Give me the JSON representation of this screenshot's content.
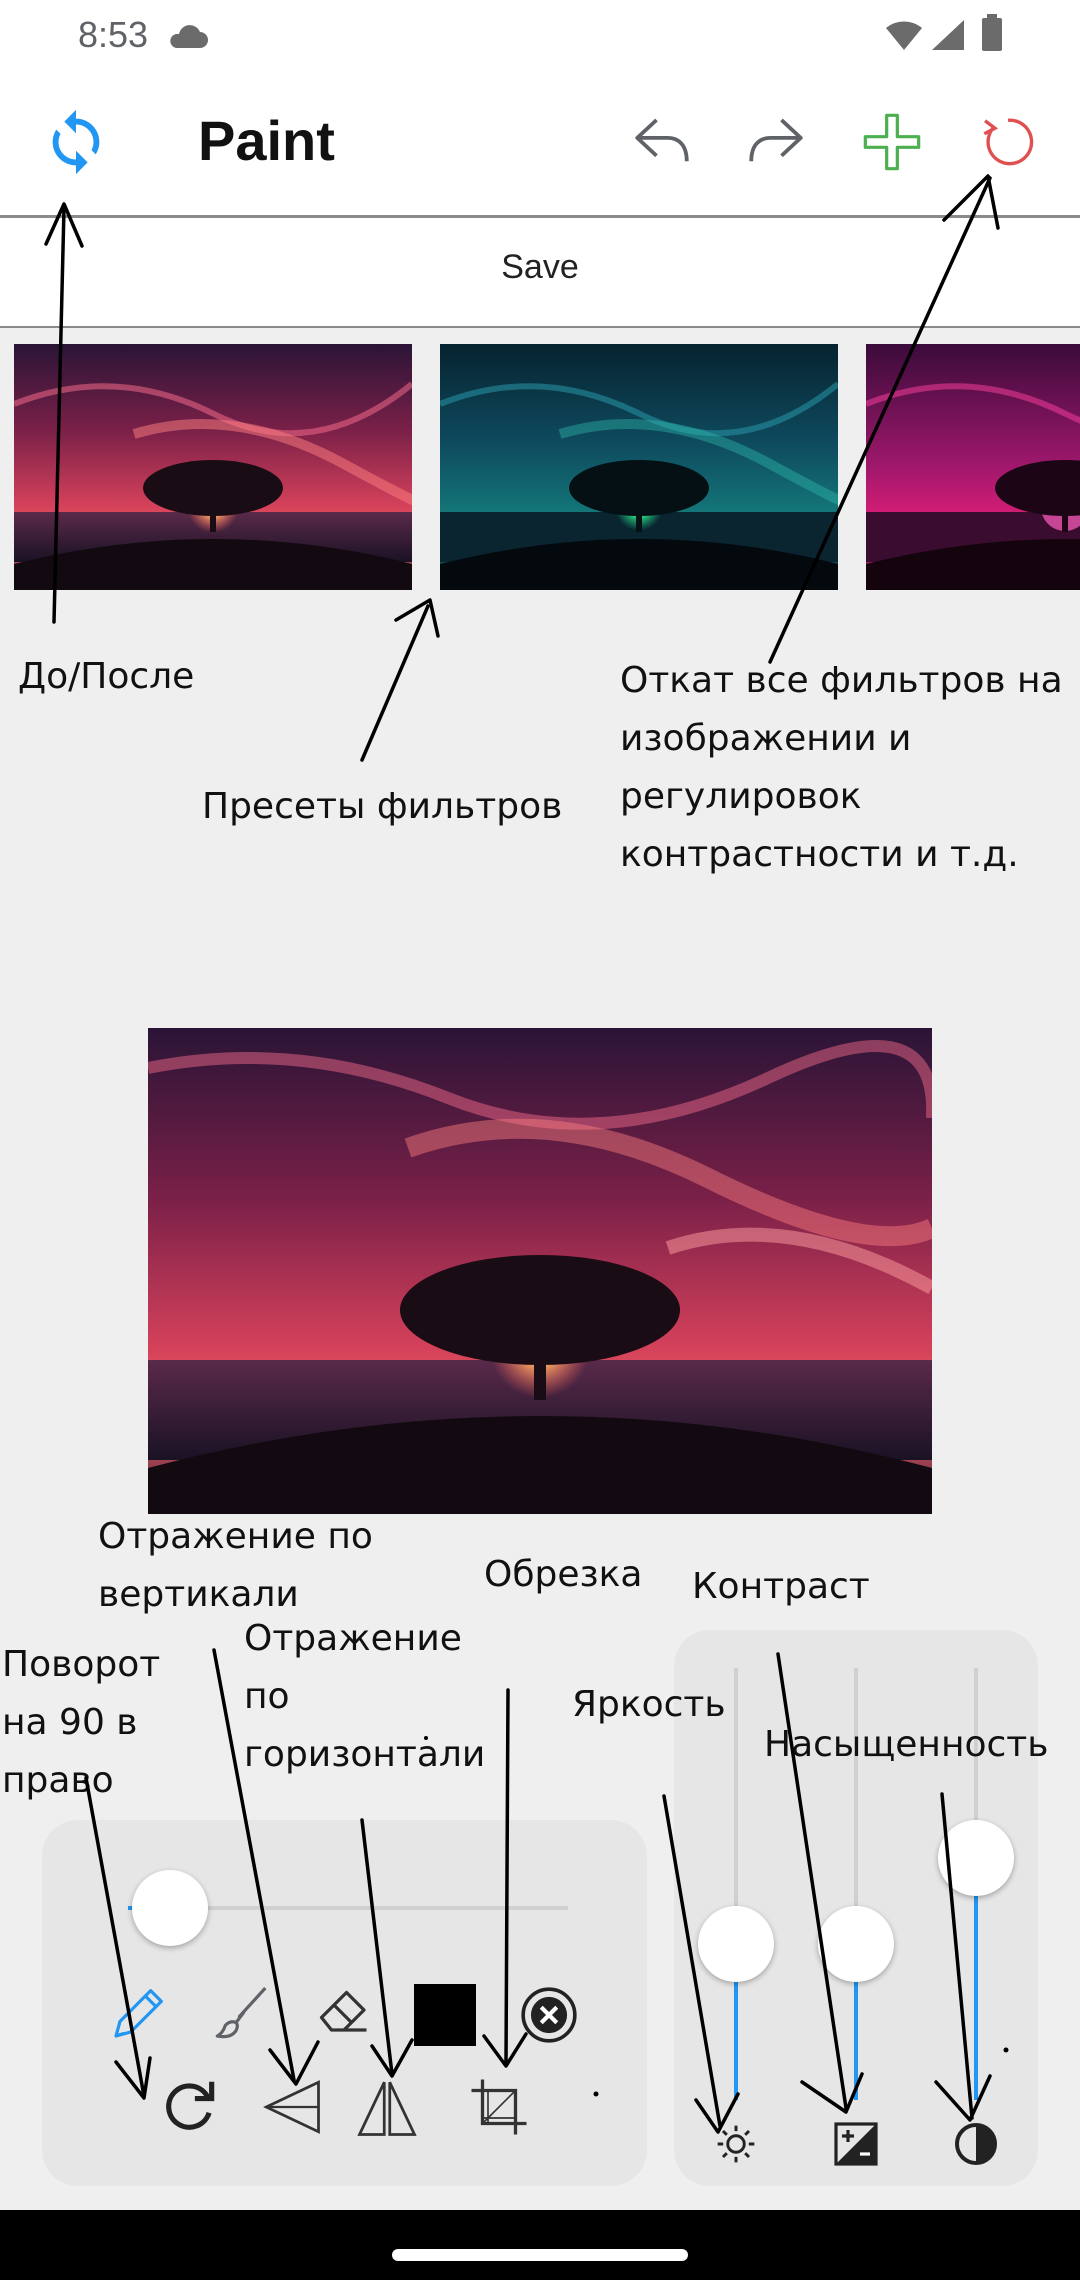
{
  "status_bar": {
    "time": "8:53"
  },
  "app_bar": {
    "title": "Paint"
  },
  "save_bar": {
    "save_label": "Save"
  },
  "annotations": {
    "before_after": "До/После",
    "presets": "Пресеты фильтров",
    "reset_lines": [
      "Откат все фильтров на",
      "изображении и",
      "регулировок",
      "контрастности и т.д."
    ],
    "flip_vertical_lines": [
      "Отражение по",
      "вертикали"
    ],
    "crop": "Обрезка",
    "contrast": "Контраст",
    "rotate_lines": [
      "Поворот",
      "на 90 в",
      "право"
    ],
    "flip_horizontal_lines": [
      "Отражение",
      "по",
      "горизонтали"
    ],
    "brightness": "Яркость",
    "saturation": "Насыщенность"
  },
  "tools": {
    "brush_size_level": 0.1,
    "selected_color": "#000000",
    "accent_color": "#2196f3"
  },
  "adjustments": {
    "brightness_level": 0.36,
    "saturation_level": 0.36,
    "contrast_level": 0.56
  },
  "icons": [
    "sync-icon",
    "undo-icon",
    "redo-icon",
    "add-icon",
    "reset-icon",
    "pencil-icon",
    "brush-icon",
    "eraser-icon",
    "clear-icon",
    "rotate-icon",
    "flip-vertical-icon",
    "flip-horizontal-icon",
    "crop-icon",
    "brightness-icon",
    "saturation-icon",
    "contrast-icon"
  ]
}
